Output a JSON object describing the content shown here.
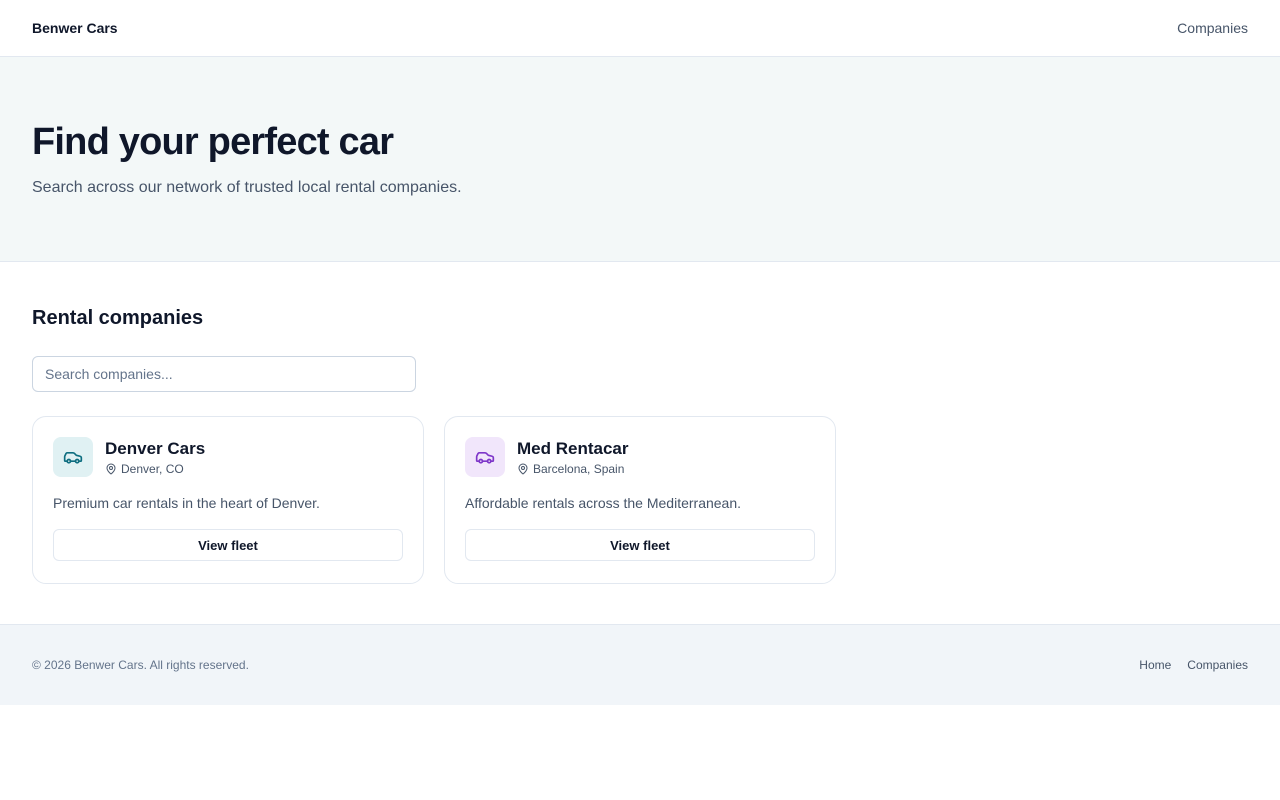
{
  "header": {
    "brand": "Benwer Cars",
    "nav_companies": "Companies"
  },
  "hero": {
    "title": "Find your perfect car",
    "subtitle": "Search across our network of trusted local rental companies."
  },
  "main": {
    "section_title": "Rental companies",
    "search": {
      "placeholder": "Search companies...",
      "value": ""
    }
  },
  "companies": [
    {
      "name": "Denver Cars",
      "location": "Denver, CO",
      "description": "Premium car rentals in the heart of Denver.",
      "button": "View fleet",
      "icon": "car-icon",
      "icon_bg": "#e0f1f3",
      "icon_color": "#0e6e80"
    },
    {
      "name": "Med Rentacar",
      "location": "Barcelona, Spain",
      "description": "Affordable rentals across the Mediterranean.",
      "button": "View fleet",
      "icon": "car-icon",
      "icon_bg": "#f1e6fb",
      "icon_color": "#7e36c9"
    }
  ],
  "footer": {
    "copyright": "© 2026 Benwer Cars. All rights reserved.",
    "links": [
      "Home",
      "Companies"
    ]
  }
}
